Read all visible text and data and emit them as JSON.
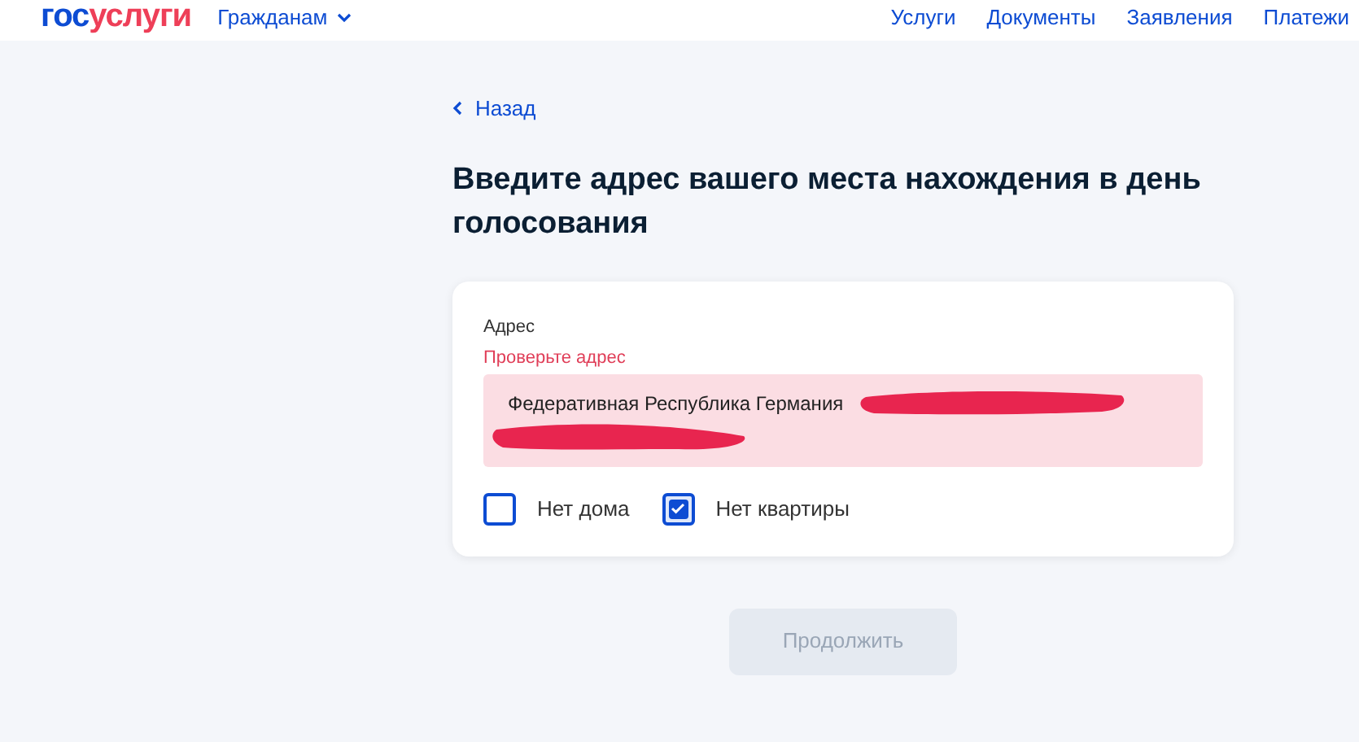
{
  "header": {
    "logo": {
      "first": "гос",
      "second": "услуги"
    },
    "menu": {
      "label": "Гражданам",
      "expanded": false
    },
    "nav": [
      "Услуги",
      "Документы",
      "Заявления",
      "Платежи"
    ]
  },
  "back_link": "Назад",
  "title": "Введите адрес вашего места нахождения в день голосования",
  "address_field": {
    "label": "Адрес",
    "error": "Проверьте адрес",
    "value": "Федеративная Республика Германия",
    "redacted": true
  },
  "checkboxes": [
    {
      "label": "Нет дома",
      "checked": false
    },
    {
      "label": "Нет квартиры",
      "checked": true
    }
  ],
  "continue_button": {
    "label": "Продолжить",
    "disabled": true
  }
}
